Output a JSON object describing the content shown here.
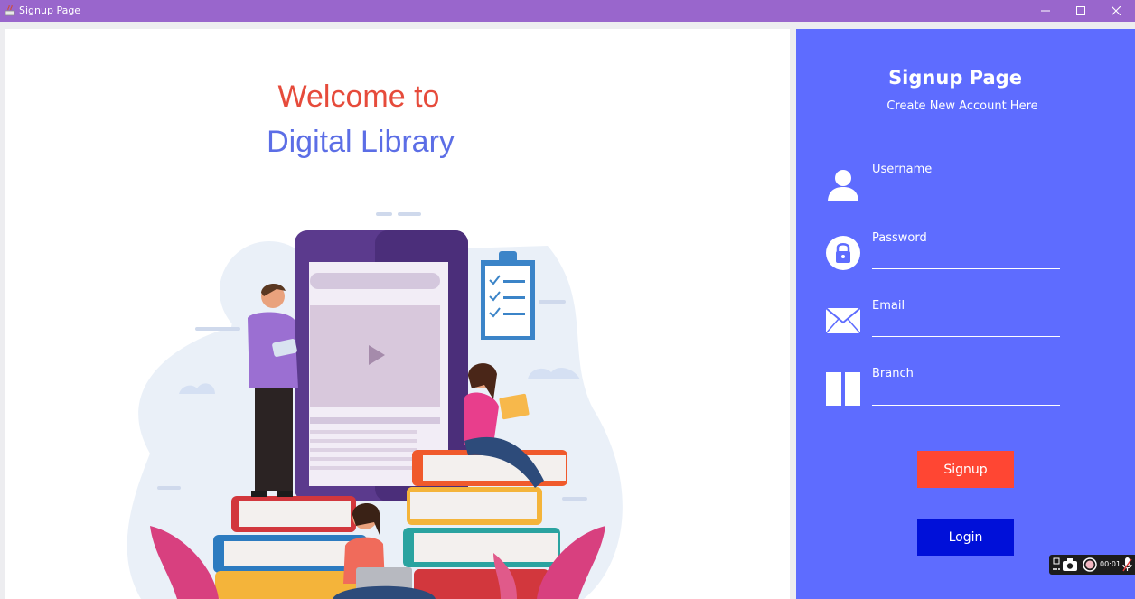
{
  "window": {
    "title": "Signup Page",
    "icons": [
      "java-app-icon",
      "minimize-icon",
      "maximize-icon",
      "close-icon"
    ]
  },
  "welcome": {
    "line1": "Welcome to",
    "line2": "Digital Library",
    "line1_color": "#e64b3b",
    "line2_color": "#5c6ee6"
  },
  "form": {
    "title": "Signup Page",
    "subtitle": "Create New Account Here",
    "panel_color": "#5e6cff",
    "fields": [
      {
        "label": "Username",
        "value": "",
        "icon": "user-icon"
      },
      {
        "label": "Password",
        "value": "",
        "icon": "lock-icon"
      },
      {
        "label": "Email",
        "value": "",
        "icon": "envelope-icon"
      },
      {
        "label": "Branch",
        "value": "",
        "icon": "branch-icon"
      }
    ],
    "signup_label": "Signup",
    "login_label": "Login",
    "signup_color": "#ff4633",
    "login_color": "#0010d9"
  },
  "recorder": {
    "time": "00:01",
    "icons": [
      "pin-icon",
      "camera-icon",
      "record-icon",
      "microphone-icon"
    ]
  }
}
